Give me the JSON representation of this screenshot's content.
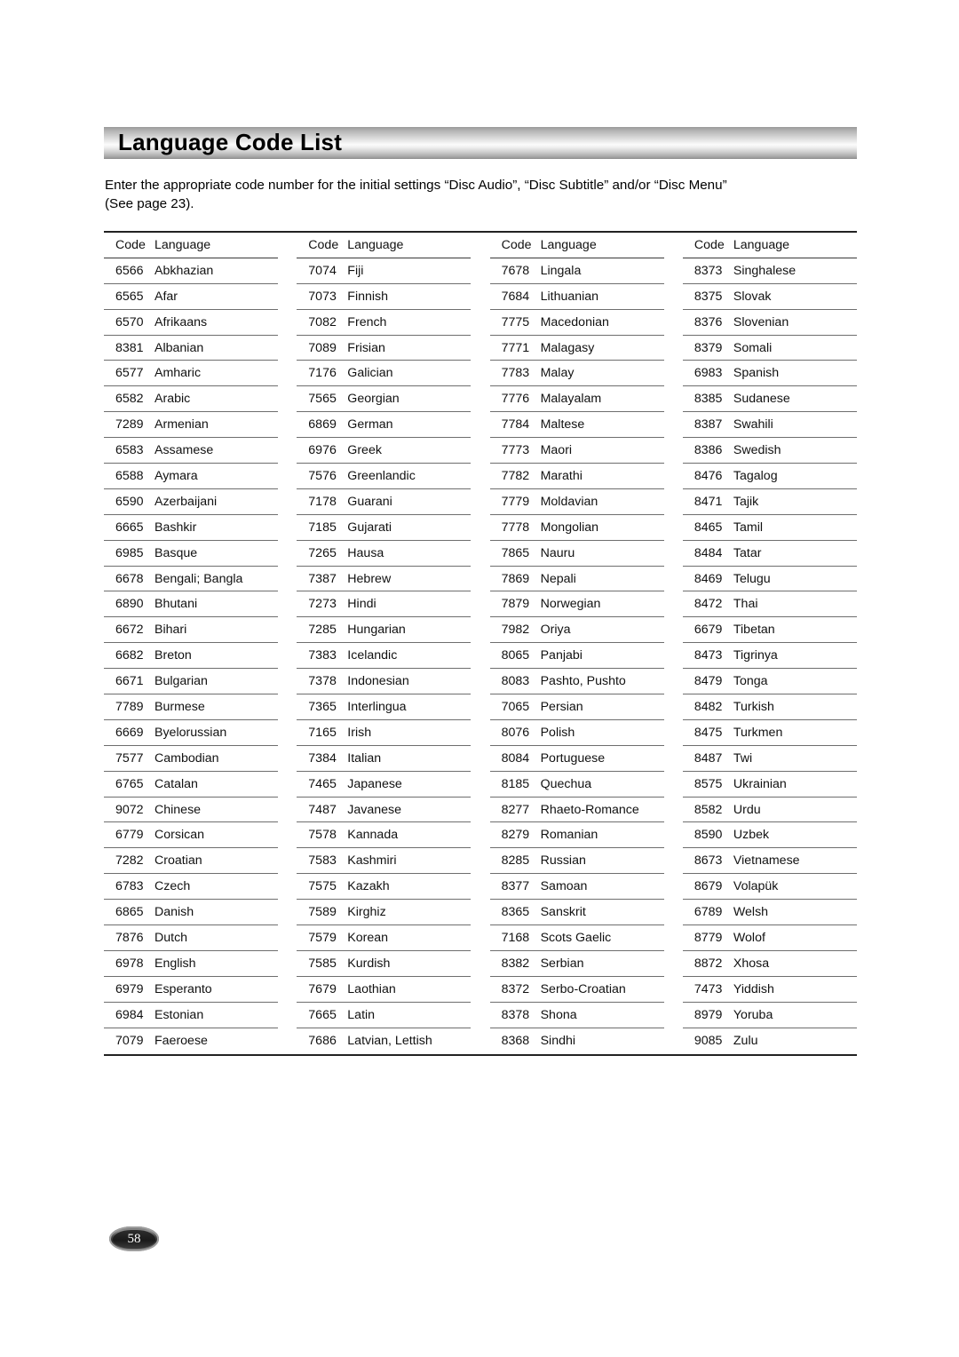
{
  "header": {
    "title": "Language Code List"
  },
  "intro": {
    "line1": "Enter the appropriate code number for the initial settings “Disc Audio”, “Disc Subtitle” and/or “Disc Menu”",
    "line2": "(See page 23)."
  },
  "table": {
    "columns": [
      {
        "header": {
          "code": "Code",
          "language": "Language"
        },
        "rows": [
          {
            "code": "6566",
            "language": "Abkhazian"
          },
          {
            "code": "6565",
            "language": "Afar"
          },
          {
            "code": "6570",
            "language": "Afrikaans"
          },
          {
            "code": "8381",
            "language": "Albanian"
          },
          {
            "code": "6577",
            "language": "Amharic"
          },
          {
            "code": "6582",
            "language": "Arabic"
          },
          {
            "code": "7289",
            "language": "Armenian"
          },
          {
            "code": "6583",
            "language": "Assamese"
          },
          {
            "code": "6588",
            "language": "Aymara"
          },
          {
            "code": "6590",
            "language": "Azerbaijani"
          },
          {
            "code": "6665",
            "language": "Bashkir"
          },
          {
            "code": "6985",
            "language": "Basque"
          },
          {
            "code": "6678",
            "language": "Bengali; Bangla"
          },
          {
            "code": "6890",
            "language": "Bhutani"
          },
          {
            "code": "6672",
            "language": "Bihari"
          },
          {
            "code": "6682",
            "language": "Breton"
          },
          {
            "code": "6671",
            "language": "Bulgarian"
          },
          {
            "code": "7789",
            "language": "Burmese"
          },
          {
            "code": "6669",
            "language": "Byelorussian"
          },
          {
            "code": "7577",
            "language": "Cambodian"
          },
          {
            "code": "6765",
            "language": "Catalan"
          },
          {
            "code": "9072",
            "language": "Chinese"
          },
          {
            "code": "6779",
            "language": "Corsican"
          },
          {
            "code": "7282",
            "language": "Croatian"
          },
          {
            "code": "6783",
            "language": "Czech"
          },
          {
            "code": "6865",
            "language": "Danish"
          },
          {
            "code": "7876",
            "language": "Dutch"
          },
          {
            "code": "6978",
            "language": "English"
          },
          {
            "code": "6979",
            "language": "Esperanto"
          },
          {
            "code": "6984",
            "language": "Estonian"
          },
          {
            "code": "7079",
            "language": "Faeroese"
          }
        ]
      },
      {
        "header": {
          "code": "Code",
          "language": "Language"
        },
        "rows": [
          {
            "code": "7074",
            "language": "Fiji"
          },
          {
            "code": "7073",
            "language": "Finnish"
          },
          {
            "code": "7082",
            "language": "French"
          },
          {
            "code": "7089",
            "language": "Frisian"
          },
          {
            "code": "7176",
            "language": "Galician"
          },
          {
            "code": "7565",
            "language": "Georgian"
          },
          {
            "code": "6869",
            "language": "German"
          },
          {
            "code": "6976",
            "language": "Greek"
          },
          {
            "code": "7576",
            "language": "Greenlandic"
          },
          {
            "code": "7178",
            "language": "Guarani"
          },
          {
            "code": "7185",
            "language": "Gujarati"
          },
          {
            "code": "7265",
            "language": "Hausa"
          },
          {
            "code": "7387",
            "language": "Hebrew"
          },
          {
            "code": "7273",
            "language": "Hindi"
          },
          {
            "code": "7285",
            "language": "Hungarian"
          },
          {
            "code": "7383",
            "language": "Icelandic"
          },
          {
            "code": "7378",
            "language": "Indonesian"
          },
          {
            "code": "7365",
            "language": "Interlingua"
          },
          {
            "code": "7165",
            "language": "Irish"
          },
          {
            "code": "7384",
            "language": "Italian"
          },
          {
            "code": "7465",
            "language": "Japanese"
          },
          {
            "code": "7487",
            "language": "Javanese"
          },
          {
            "code": "7578",
            "language": "Kannada"
          },
          {
            "code": "7583",
            "language": "Kashmiri"
          },
          {
            "code": "7575",
            "language": "Kazakh"
          },
          {
            "code": "7589",
            "language": "Kirghiz"
          },
          {
            "code": "7579",
            "language": "Korean"
          },
          {
            "code": "7585",
            "language": "Kurdish"
          },
          {
            "code": "7679",
            "language": "Laothian"
          },
          {
            "code": "7665",
            "language": "Latin"
          },
          {
            "code": "7686",
            "language": "Latvian, Lettish"
          }
        ]
      },
      {
        "header": {
          "code": "Code",
          "language": "Language"
        },
        "rows": [
          {
            "code": "7678",
            "language": "Lingala"
          },
          {
            "code": "7684",
            "language": "Lithuanian"
          },
          {
            "code": "7775",
            "language": "Macedonian"
          },
          {
            "code": "7771",
            "language": "Malagasy"
          },
          {
            "code": "7783",
            "language": "Malay"
          },
          {
            "code": "7776",
            "language": "Malayalam"
          },
          {
            "code": "7784",
            "language": "Maltese"
          },
          {
            "code": "7773",
            "language": "Maori"
          },
          {
            "code": "7782",
            "language": "Marathi"
          },
          {
            "code": "7779",
            "language": "Moldavian"
          },
          {
            "code": "7778",
            "language": "Mongolian"
          },
          {
            "code": "7865",
            "language": "Nauru"
          },
          {
            "code": "7869",
            "language": "Nepali"
          },
          {
            "code": "7879",
            "language": "Norwegian"
          },
          {
            "code": "7982",
            "language": "Oriya"
          },
          {
            "code": "8065",
            "language": "Panjabi"
          },
          {
            "code": "8083",
            "language": "Pashto, Pushto"
          },
          {
            "code": "7065",
            "language": "Persian"
          },
          {
            "code": "8076",
            "language": "Polish"
          },
          {
            "code": "8084",
            "language": "Portuguese"
          },
          {
            "code": "8185",
            "language": "Quechua"
          },
          {
            "code": "8277",
            "language": "Rhaeto-Romance"
          },
          {
            "code": "8279",
            "language": "Romanian"
          },
          {
            "code": "8285",
            "language": "Russian"
          },
          {
            "code": "8377",
            "language": "Samoan"
          },
          {
            "code": "8365",
            "language": "Sanskrit"
          },
          {
            "code": "7168",
            "language": "Scots Gaelic"
          },
          {
            "code": "8382",
            "language": "Serbian"
          },
          {
            "code": "8372",
            "language": "Serbo-Croatian"
          },
          {
            "code": "8378",
            "language": "Shona"
          },
          {
            "code": "8368",
            "language": "Sindhi"
          }
        ]
      },
      {
        "header": {
          "code": "Code",
          "language": "Language"
        },
        "rows": [
          {
            "code": "8373",
            "language": "Singhalese"
          },
          {
            "code": "8375",
            "language": "Slovak"
          },
          {
            "code": "8376",
            "language": "Slovenian"
          },
          {
            "code": "8379",
            "language": "Somali"
          },
          {
            "code": "6983",
            "language": "Spanish"
          },
          {
            "code": "8385",
            "language": "Sudanese"
          },
          {
            "code": "8387",
            "language": "Swahili"
          },
          {
            "code": "8386",
            "language": "Swedish"
          },
          {
            "code": "8476",
            "language": "Tagalog"
          },
          {
            "code": "8471",
            "language": "Tajik"
          },
          {
            "code": "8465",
            "language": "Tamil"
          },
          {
            "code": "8484",
            "language": "Tatar"
          },
          {
            "code": "8469",
            "language": "Telugu"
          },
          {
            "code": "8472",
            "language": "Thai"
          },
          {
            "code": "6679",
            "language": "Tibetan"
          },
          {
            "code": "8473",
            "language": "Tigrinya"
          },
          {
            "code": "8479",
            "language": "Tonga"
          },
          {
            "code": "8482",
            "language": "Turkish"
          },
          {
            "code": "8475",
            "language": "Turkmen"
          },
          {
            "code": "8487",
            "language": "Twi"
          },
          {
            "code": "8575",
            "language": "Ukrainian"
          },
          {
            "code": "8582",
            "language": "Urdu"
          },
          {
            "code": "8590",
            "language": "Uzbek"
          },
          {
            "code": "8673",
            "language": "Vietnamese"
          },
          {
            "code": "8679",
            "language": "Volapük"
          },
          {
            "code": "6789",
            "language": "Welsh"
          },
          {
            "code": "8779",
            "language": "Wolof"
          },
          {
            "code": "8872",
            "language": "Xhosa"
          },
          {
            "code": "7473",
            "language": "Yiddish"
          },
          {
            "code": "8979",
            "language": "Yoruba"
          },
          {
            "code": "9085",
            "language": "Zulu"
          }
        ]
      }
    ]
  },
  "footer": {
    "page_number": "58"
  }
}
